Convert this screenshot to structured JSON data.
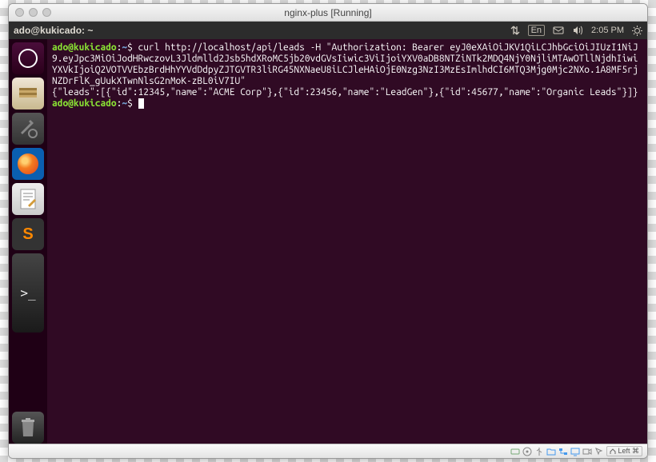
{
  "mac_title": "nginx-plus [Running]",
  "menubar": {
    "title": "ado@kukicado: ~",
    "lang": "En",
    "time": "2:05 PM"
  },
  "launcher": {
    "dash": "dash",
    "files": "files",
    "settings": "settings",
    "firefox": "firefox",
    "gedit": "text-editor",
    "sublime": "sublime",
    "terminal": "terminal",
    "trash": "trash"
  },
  "terminal": {
    "line1_user": "ado@kukicado",
    "line1_path": "~",
    "line1_cmd": "curl http://localhost/api/leads -H \"Authorization: Bearer eyJ0eXAiOiJKV1QiLCJhbGciOiJIUzI1NiJ9.eyJpc3MiOiJodHRwczovL3Jldmlld2Jsb5hdXRoMC5jb20vdGVsIiwic3ViIjoiYXV0aDB8NTZiNTk2MDQ4NjY0NjliMTAwOTllNjdhIiwiYXVkIjoiQ2VOTVVEbzBrdHhYYVdDdpyZJTGVTR3liRG45NXNaeU8iLCJleHAiOjE0Nzg3NzI3MzEsImlhdCI6MTQ3Mjg0Mjc2NXo.1A8MF5rjNZDrFlK_gUukXTwnNlsG2nMoK-zBL0iV7IU\"",
    "line2_output": "{\"leads\":[{\"id\":12345,\"name\":\"ACME Corp\"},{\"id\":23456,\"name\":\"LeadGen\"},{\"id\":45677,\"name\":\"Organic Leads\"}]}",
    "line2_user": "ado@kukicado",
    "line2_path": "~"
  },
  "statusbar": {
    "left_label": "Left",
    "cmd_key": "⌘"
  }
}
